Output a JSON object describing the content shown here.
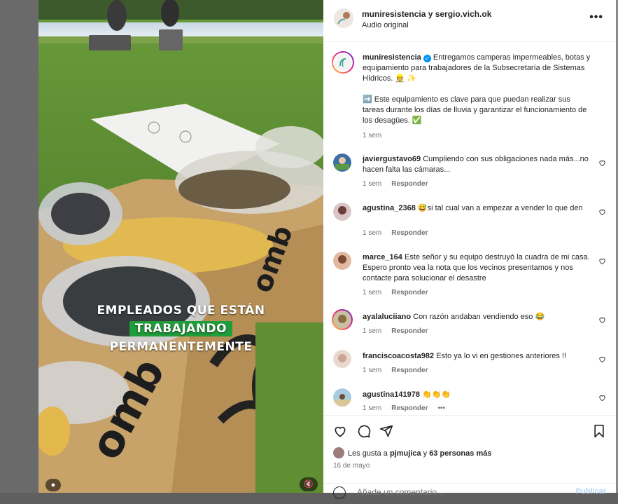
{
  "video": {
    "caption_line1": "EMPLEADOS QUE ESTÁN",
    "caption_line2": "TRABAJANDO",
    "caption_line3": "PERMANENTEMENTE",
    "highlight_color": "#1f9d3a",
    "mute_icon": "speaker-muted-icon"
  },
  "header": {
    "title": "muniresistencia y sergio.vich.ok",
    "subtitle": "Audio original",
    "more_icon": "more-horizontal-icon"
  },
  "post": {
    "username": "muniresistencia",
    "text_p1": "Entregamos camperas impermeables, botas y equipamiento para trabajadores de la Subsecretaría de Sistemas Hídricos. 👷 ✨",
    "text_p2": "➡️ Este equipamiento es clave para que puedan realizar sus tareas durante los días de lluvia y garantizar el funcionamiento de los desagües. ✅",
    "time": "1 sem",
    "verified_color": "#0095f6"
  },
  "comments": [
    {
      "user": "javiergustavo69",
      "text": "Cumpliendo con sus obligaciones nada más...no hacen falta las cámaras...",
      "time": "1 sem",
      "reply": "Responder"
    },
    {
      "user": "agustina_2368",
      "text": "😅si tal cual van a empezar a vender lo que den",
      "time": "1 sem",
      "reply": "Responder"
    },
    {
      "user": "marce_164",
      "text": "Este señor y su equipo destruyó la cuadra de mi casa. Espero pronto vea la nota que los vecinos presentamos y nos contacte para solucionar el desastre",
      "time": "1 sem",
      "reply": "Responder"
    },
    {
      "user": "ayalaluciiano",
      "text": "Con razón andaban vendiendo eso 😂",
      "time": "1 sem",
      "reply": "Responder"
    },
    {
      "user": "franciscoacosta982",
      "text": "Esto ya lo vi en gestiones anteriores !!",
      "time": "1 sem",
      "reply": "Responder"
    },
    {
      "user": "agustina141978",
      "text": "👏👏👏",
      "time": "1 sem",
      "reply": "Responder",
      "more": "•••"
    }
  ],
  "actions": {
    "likes_prefix": "Les gusta a",
    "likes_user": "pjmujica",
    "likes_mid": "y",
    "likes_count": "63 personas más",
    "date": "16 de mayo",
    "add_comment_placeholder": "Añade un comentario...",
    "publish_label": "Publicar"
  }
}
